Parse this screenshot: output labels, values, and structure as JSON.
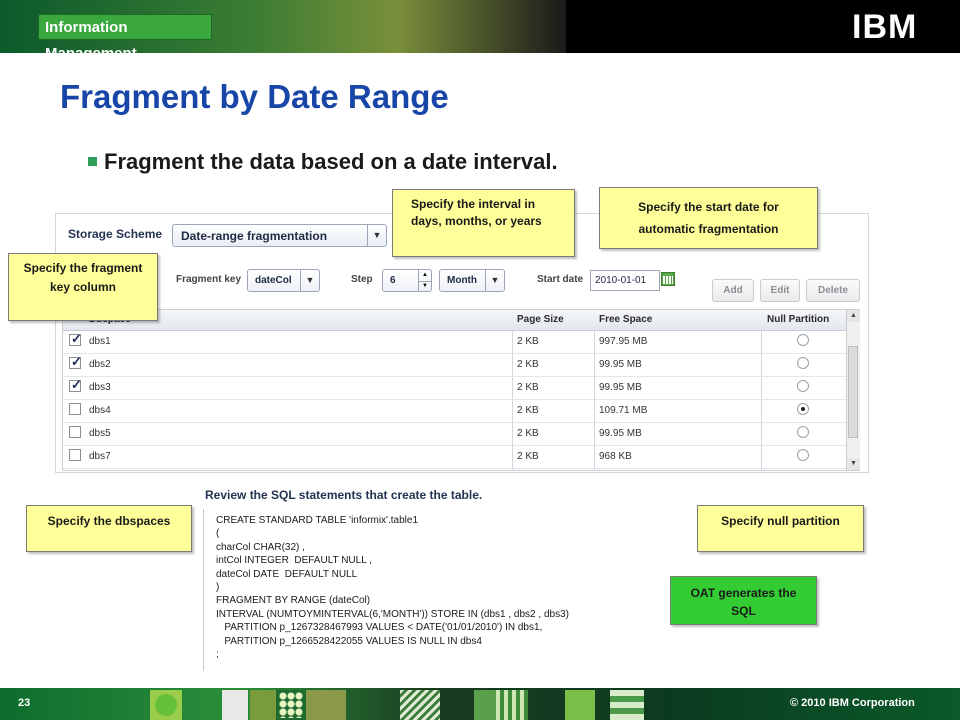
{
  "header": {
    "badge": "Information Management",
    "logo": "IBM"
  },
  "slide": {
    "title": "Fragment by Date Range",
    "bullet": "Fragment the data based on a date interval."
  },
  "form": {
    "storage_scheme_label": "Storage Scheme",
    "storage_scheme_value": "Date-range fragmentation",
    "fragment_key_label": "Fragment key",
    "fragment_key_value": "dateCol",
    "step_label": "Step",
    "step_value": "6",
    "step_unit": "Month",
    "start_date_label": "Start date",
    "start_date_value": "2010-01-01",
    "buttons": {
      "add": "Add",
      "edit": "Edit",
      "delete": "Delete"
    }
  },
  "table": {
    "columns": [
      "Dbspace",
      "Page Size",
      "Free Space",
      "Null Partition"
    ],
    "rows": [
      {
        "name": "dbs1",
        "page_size": "2 KB",
        "free_space": "997.95 MB",
        "checked": true,
        "null_partition": false
      },
      {
        "name": "dbs2",
        "page_size": "2 KB",
        "free_space": "99.95 MB",
        "checked": true,
        "null_partition": false
      },
      {
        "name": "dbs3",
        "page_size": "2 KB",
        "free_space": "99.95 MB",
        "checked": true,
        "null_partition": false
      },
      {
        "name": "dbs4",
        "page_size": "2 KB",
        "free_space": "109.71 MB",
        "checked": false,
        "null_partition": true
      },
      {
        "name": "dbs5",
        "page_size": "2 KB",
        "free_space": "99.95 MB",
        "checked": false,
        "null_partition": false
      },
      {
        "name": "dbs7",
        "page_size": "2 KB",
        "free_space": "968 KB",
        "checked": false,
        "null_partition": false
      }
    ]
  },
  "sql": {
    "heading": "Review the SQL statements that create the table.",
    "lines": [
      "CREATE STANDARD TABLE 'informix'.table1",
      "(",
      "charCol CHAR(32) ,",
      "intCol INTEGER  DEFAULT NULL ,",
      "dateCol DATE  DEFAULT NULL",
      ")",
      "FRAGMENT BY RANGE (dateCol)",
      "INTERVAL (NUMTOYMINTERVAL(6,'MONTH')) STORE IN (dbs1 , dbs2 , dbs3)",
      "   PARTITION p_1267328467993 VALUES < DATE('01/01/2010') IN dbs1,",
      "   PARTITION p_1266528422055 VALUES IS NULL IN dbs4",
      ";"
    ]
  },
  "callouts": {
    "interval": "Specify the interval in days, months, or years",
    "start_date": "Specify the start date for automatic fragmentation",
    "fragment_key": "Specify  the fragment key column",
    "dbspaces": "Specify the dbspaces",
    "null_partition": "Specify null partition",
    "oat": "OAT generates the SQL"
  },
  "footer": {
    "page": "23",
    "copyright": "© 2010 IBM Corporation"
  },
  "colors": {
    "title_blue": "#1846a8",
    "callout_yellow": "#ffff99",
    "callout_green": "#33cc33",
    "badge_green": "#3aa83e"
  }
}
